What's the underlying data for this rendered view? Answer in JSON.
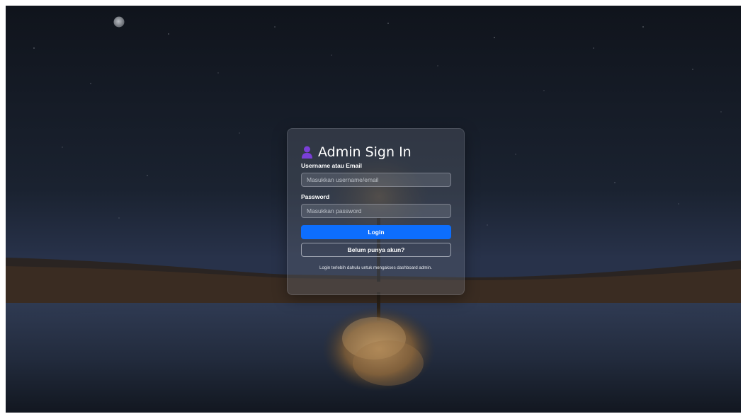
{
  "login_card": {
    "title": "Admin Sign In",
    "title_icon": "user-icon",
    "username_label": "Username atau Email",
    "username_placeholder": "Masukkan username/email",
    "username_value": "",
    "password_label": "Password",
    "password_placeholder": "Masukkan password",
    "password_value": "",
    "login_button_label": "Login",
    "register_button_label": "Belum punya akun?",
    "helper_text": "Login terlebih dahulu untuk mengakses dashboard admin."
  },
  "colors": {
    "primary_button": "#0d6efd",
    "icon_purple": "#6f42c1"
  },
  "background": {
    "scene": "night sky with stars and moon over a lake with a reflected tree"
  }
}
